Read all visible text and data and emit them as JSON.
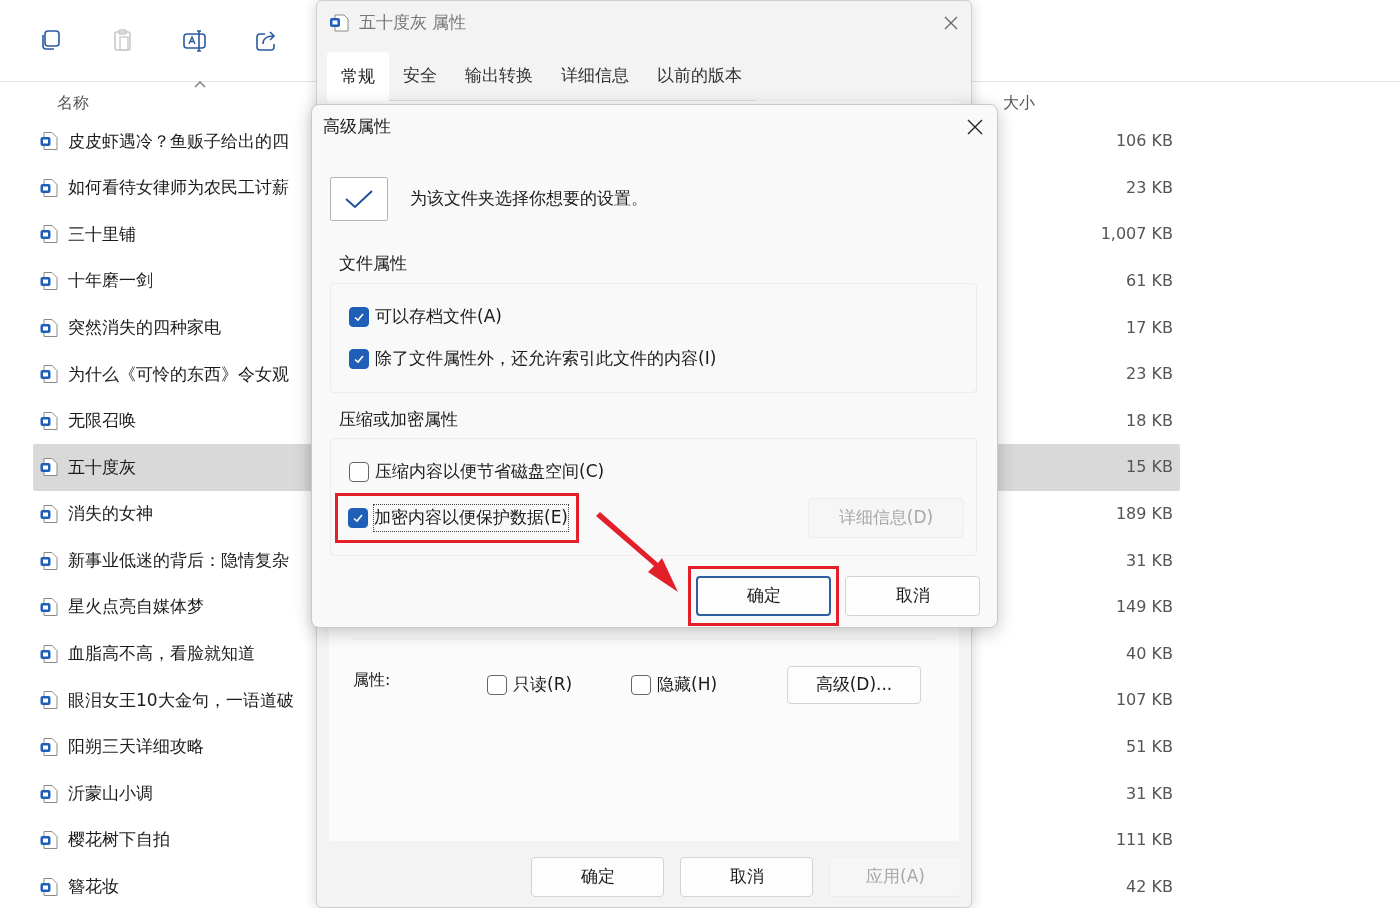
{
  "explorer": {
    "toolbar": [
      {
        "kind": "copy",
        "disabled": false
      },
      {
        "kind": "paste",
        "disabled": true
      },
      {
        "kind": "rename",
        "disabled": false
      },
      {
        "kind": "share",
        "disabled": false
      }
    ],
    "columns": [
      {
        "label": "名称",
        "sorted": true
      },
      {
        "label": "大小",
        "sorted": false
      }
    ],
    "files": [
      {
        "name": "皮皮虾遇冷？鱼贩子给出的四",
        "size": "106 KB",
        "selected": false
      },
      {
        "name": "如何看待女律师为农民工讨薪",
        "size": "23 KB",
        "selected": false
      },
      {
        "name": "三十里铺",
        "size": "1,007 KB",
        "selected": false
      },
      {
        "name": "十年磨一剑",
        "size": "61 KB",
        "selected": false
      },
      {
        "name": "突然消失的四种家电",
        "size": "17 KB",
        "selected": false
      },
      {
        "name": "为什么《可怜的东西》令女观",
        "size": "23 KB",
        "selected": false
      },
      {
        "name": "无限召唤",
        "size": "18 KB",
        "selected": false
      },
      {
        "name": "五十度灰",
        "size": "15 KB",
        "selected": true
      },
      {
        "name": "消失的女神",
        "size": "189 KB",
        "selected": false
      },
      {
        "name": "新事业低迷的背后：隐情复杂",
        "size": "31 KB",
        "selected": false
      },
      {
        "name": "星火点亮自媒体梦",
        "size": "149 KB",
        "selected": false
      },
      {
        "name": "血脂高不高，看脸就知道",
        "size": "40 KB",
        "selected": false
      },
      {
        "name": "眼泪女王10大金句，一语道破",
        "size": "107 KB",
        "selected": false
      },
      {
        "name": "阳朔三天详细攻略",
        "size": "51 KB",
        "selected": false
      },
      {
        "name": "沂蒙山小调",
        "size": "31 KB",
        "selected": false
      },
      {
        "name": "樱花树下自拍",
        "size": "111 KB",
        "selected": false
      },
      {
        "name": "簪花妆",
        "size": "42 KB",
        "selected": false
      }
    ]
  },
  "properties_window": {
    "title": "五十度灰 属性",
    "tabs": [
      {
        "label": "常规",
        "selected": true
      },
      {
        "label": "安全",
        "selected": false
      },
      {
        "label": "输出转换",
        "selected": false
      },
      {
        "label": "详细信息",
        "selected": false
      },
      {
        "label": "以前的版本",
        "selected": false
      }
    ],
    "attributes_label": "属性:",
    "attributes": [
      {
        "label": "只读(R)",
        "checked": false
      },
      {
        "label": "隐藏(H)",
        "checked": false
      }
    ],
    "advanced_button": "高级(D)...",
    "buttons": [
      {
        "label": "确定",
        "disabled": false
      },
      {
        "label": "取消",
        "disabled": false
      },
      {
        "label": "应用(A)",
        "disabled": true
      }
    ]
  },
  "advanced_dialog": {
    "title": "高级属性",
    "description": "为该文件夹选择你想要的设置。",
    "groups": [
      {
        "title": "文件属性",
        "options": [
          {
            "label": "可以存档文件(A)",
            "checked": true,
            "focused": false,
            "highlighted": false
          },
          {
            "label": "除了文件属性外，还允许索引此文件的内容(I)",
            "checked": true,
            "focused": false,
            "highlighted": false
          }
        ]
      },
      {
        "title": "压缩或加密属性",
        "options": [
          {
            "label": "压缩内容以便节省磁盘空间(C)",
            "checked": false,
            "focused": false,
            "highlighted": false
          },
          {
            "label": "加密内容以便保护数据(E)",
            "checked": true,
            "focused": true,
            "highlighted": true
          }
        ],
        "details_button": {
          "label": "详细信息(D)",
          "disabled": true
        }
      }
    ],
    "buttons": [
      {
        "label": "确定",
        "default": true,
        "highlighted": true
      },
      {
        "label": "取消",
        "default": false,
        "highlighted": false
      }
    ]
  }
}
